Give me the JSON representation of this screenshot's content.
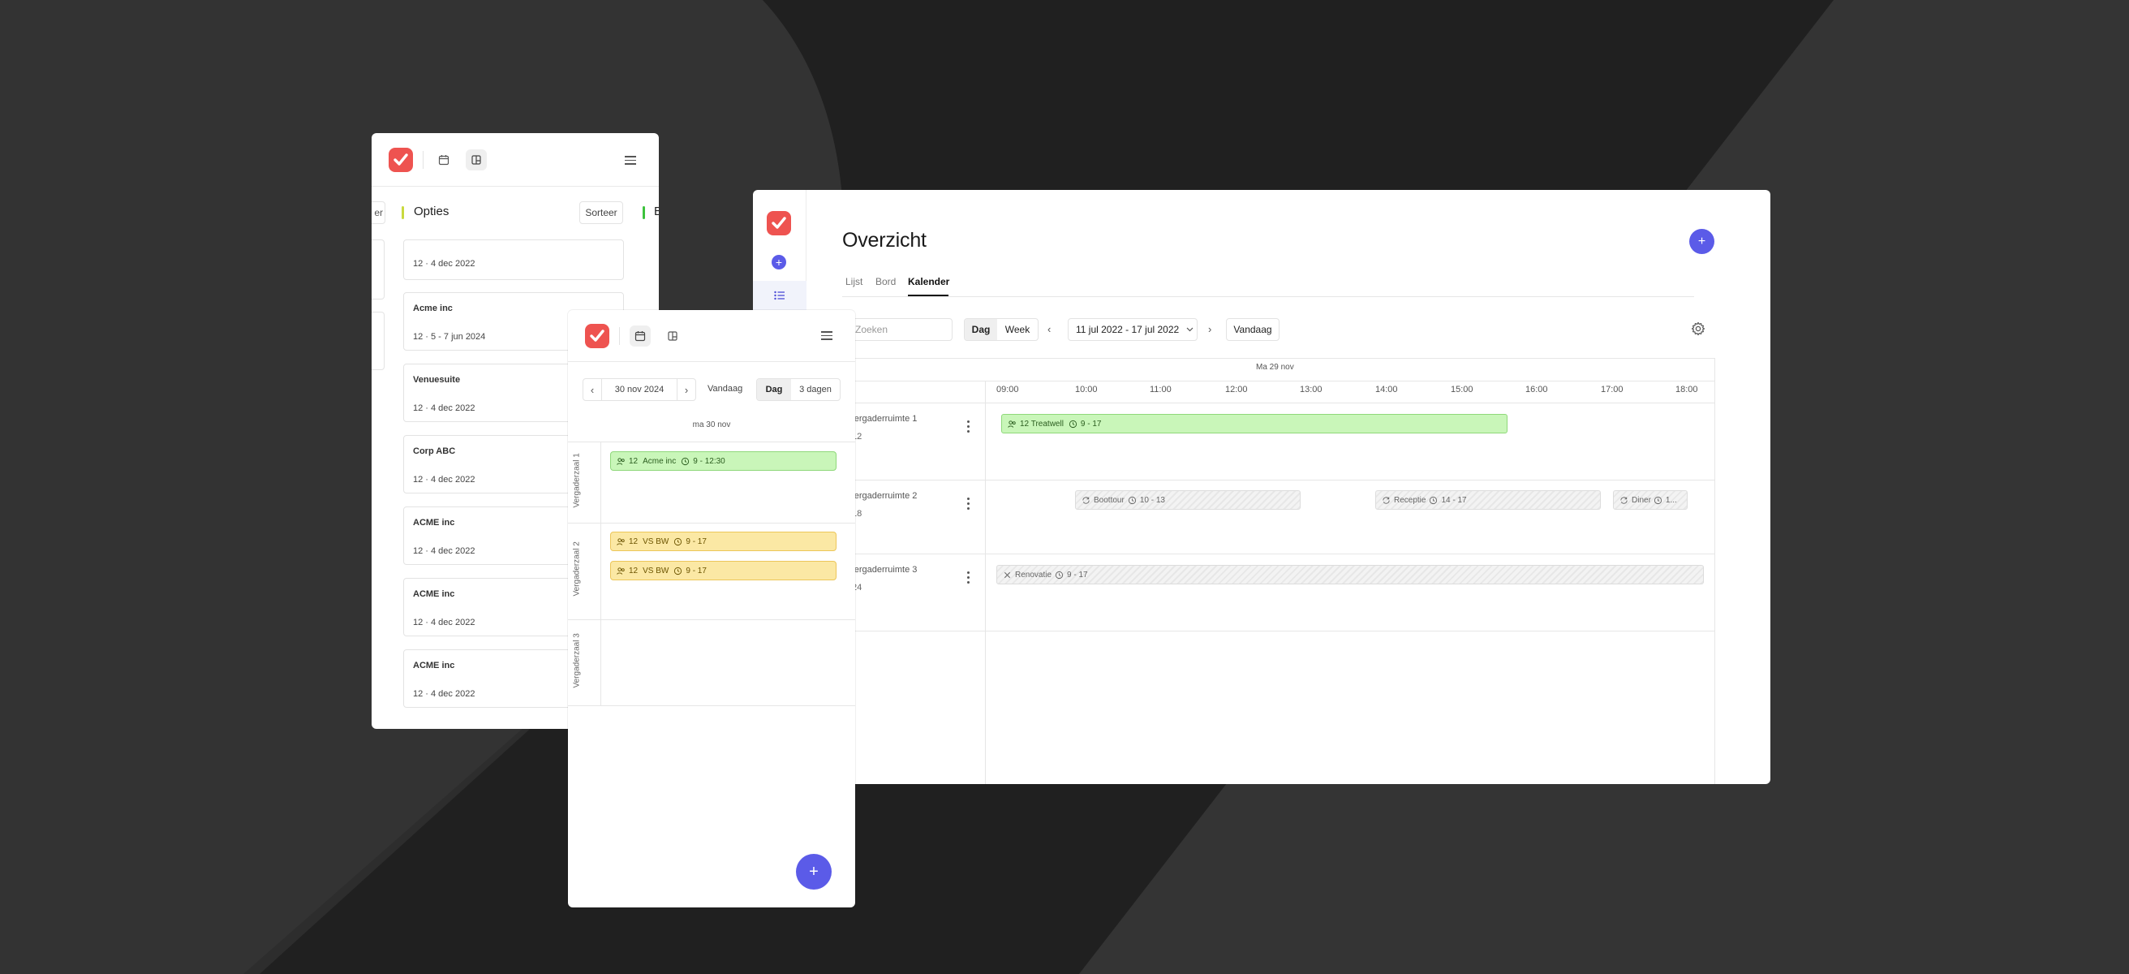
{
  "colors": {
    "background": "#2a2a2a",
    "brand": "#ee5350",
    "accent": "#5b5be8",
    "green_event": "#c9f6b9",
    "yellow_event": "#fbe8a4"
  },
  "board": {
    "column_left_partial": "er",
    "column_title": "Opties",
    "sort_label": "Sorteer",
    "column_right_partial": "B",
    "cards": [
      {
        "title": "",
        "date": "12 · 4 dec 2022"
      },
      {
        "title": "Acme inc",
        "date": "12 · 5 - 7 jun 2024"
      },
      {
        "title": "Venuesuite",
        "date": "12 · 4 dec 2022"
      },
      {
        "title": "Corp ABC",
        "date": "12 · 4 dec 2022"
      },
      {
        "title": "ACME inc",
        "date": "12 · 4 dec 2022"
      },
      {
        "title": "ACME inc",
        "date": "12 · 4 dec 2022"
      },
      {
        "title": "ACME inc",
        "date": "12 · 4 dec 2022"
      }
    ]
  },
  "overview": {
    "title": "Overzicht",
    "tabs": [
      "Lijst",
      "Bord",
      "Kalender"
    ],
    "active_tab": "Kalender",
    "search_placeholder": "Zoeken",
    "views": [
      "Dag",
      "Week"
    ],
    "active_view": "Dag",
    "date_range": "11 jul 2022 - 17 jul 2022",
    "today_label": "Vandaag",
    "day_header": "Ma 29 nov",
    "hours": [
      "09:00",
      "10:00",
      "11:00",
      "12:00",
      "13:00",
      "14:00",
      "15:00",
      "16:00",
      "17:00",
      "18:00"
    ],
    "rooms": [
      {
        "name": "Vergaderruimte 1",
        "capacity": "12"
      },
      {
        "name": "Vergaderruimte 2",
        "capacity": "18"
      },
      {
        "name": "Vergaderruimte 3",
        "capacity": "24"
      }
    ],
    "events": [
      {
        "label": "12 Treatwell",
        "time": "9 - 17"
      },
      {
        "label": "Boottour",
        "time": "10 - 13"
      },
      {
        "label": "Receptie",
        "time": "14 - 17"
      },
      {
        "label": "Diner",
        "time": "1..."
      },
      {
        "label": "Renovatie",
        "time": "9 - 17"
      }
    ]
  },
  "dayview": {
    "date": "30 nov 2024",
    "today_label": "Vandaag",
    "views": [
      "Dag",
      "3 dagen"
    ],
    "active_view": "Dag",
    "day_header": "ma 30 nov",
    "rooms": [
      "Vergaderzaal 1",
      "Vergaderzaal 2",
      "Vergaderzaal 3"
    ],
    "events": [
      {
        "count": "12",
        "name": "Acme inc",
        "time": "9 - 12:30"
      },
      {
        "count": "12",
        "name": "VS BW",
        "time": "9 - 17"
      },
      {
        "count": "12",
        "name": "VS BW",
        "time": "9 - 17"
      }
    ]
  }
}
